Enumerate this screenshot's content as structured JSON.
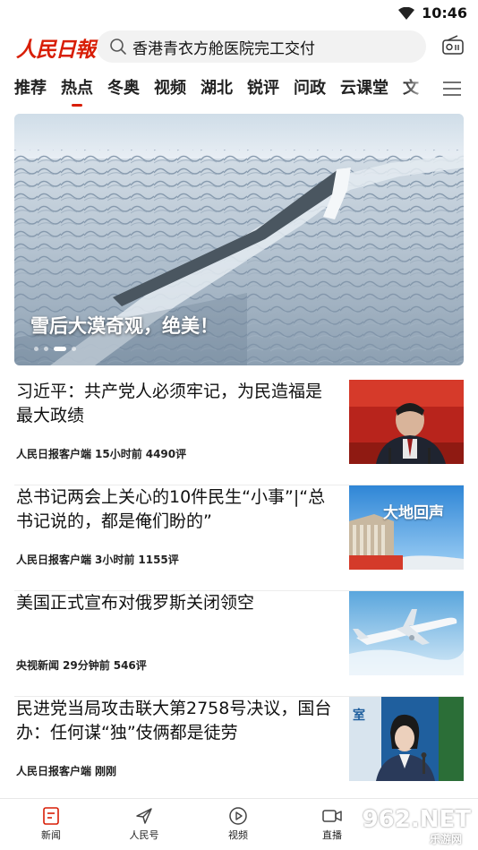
{
  "status_bar": {
    "time": "10:46"
  },
  "header": {
    "logo_text": "人民日報",
    "search_text": "香港青衣方舱医院完工交付"
  },
  "tabs": [
    {
      "label": "推荐",
      "active": false
    },
    {
      "label": "热点",
      "active": true
    },
    {
      "label": "冬奥",
      "active": false
    },
    {
      "label": "视频",
      "active": false
    },
    {
      "label": "湖北",
      "active": false
    },
    {
      "label": "锐评",
      "active": false
    },
    {
      "label": "问政",
      "active": false
    },
    {
      "label": "云课堂",
      "active": false
    },
    {
      "label": "文",
      "active": false
    }
  ],
  "banner": {
    "caption": "雪后大漠奇观，绝美！",
    "slide_count": 4,
    "active_slide": 3
  },
  "news": [
    {
      "title": "习近平：共产党人必须牢记，为民造福是最大政绩",
      "source": "人民日报客户端",
      "time": "15小时前",
      "comments": "4490评"
    },
    {
      "title": "总书记两会上关心的10件民生“小事”|“总书记说的，都是俺们盼的”",
      "source": "人民日报客户端",
      "time": "3小时前",
      "comments": "1155评",
      "thumb_text": "大地回声"
    },
    {
      "title": "美国正式宣布对俄罗斯关闭领空",
      "source": "央视新闻",
      "time": "29分钟前",
      "comments": "546评"
    },
    {
      "title": "民进党当局攻击联大第2758号决议，国台办：任何谋“独”伎俩都是徒劳",
      "source": "人民日报客户端",
      "time": "刚刚",
      "comments": "",
      "thumb_text": "室"
    }
  ],
  "bottom_nav": [
    {
      "label": "新闻",
      "icon": "news-icon"
    },
    {
      "label": "人民号",
      "icon": "send-icon"
    },
    {
      "label": "视频",
      "icon": "play-icon"
    },
    {
      "label": "直播",
      "icon": "camera-icon"
    }
  ],
  "watermark": {
    "main": "962.NET",
    "sub": "乐游网"
  },
  "colors": {
    "brand": "#d81e06",
    "text": "#111111",
    "divider": "#ececec"
  }
}
